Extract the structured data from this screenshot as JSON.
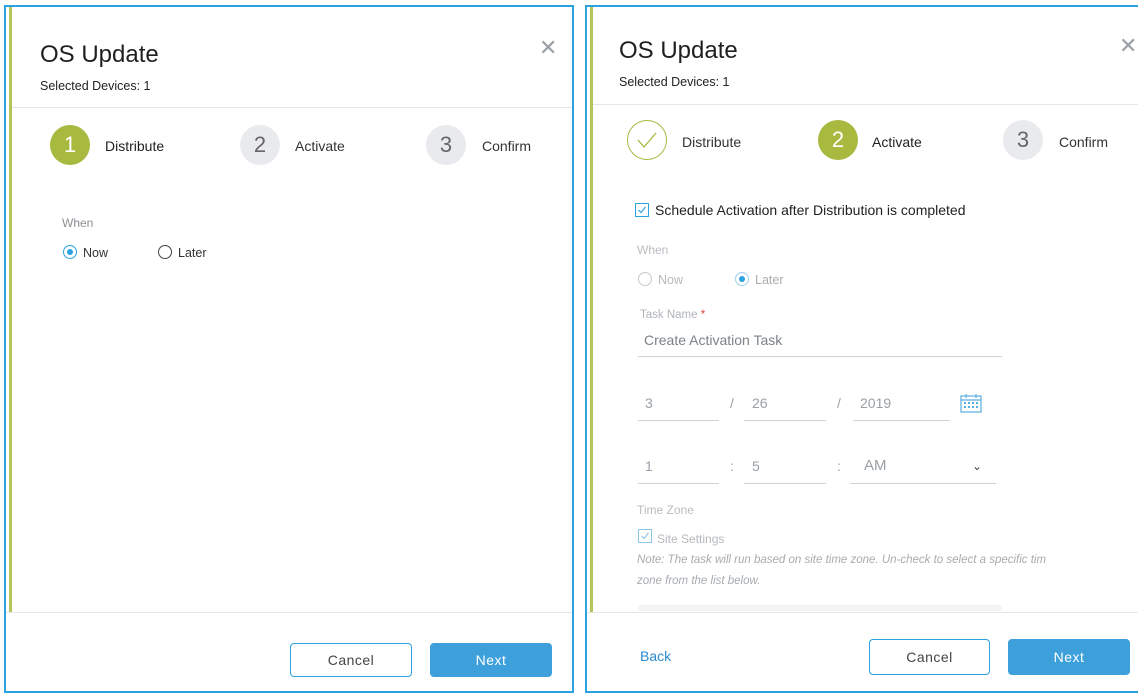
{
  "left": {
    "title": "OS Update",
    "subtitle": "Selected Devices: 1",
    "steps": [
      {
        "number": "1",
        "label": "Distribute",
        "state": "active"
      },
      {
        "number": "2",
        "label": "Activate",
        "state": "inactive"
      },
      {
        "number": "3",
        "label": "Confirm",
        "state": "inactive"
      }
    ],
    "when_label": "When",
    "radio_now": "Now",
    "radio_later": "Later",
    "selected": "Now",
    "cancel_label": "Cancel",
    "next_label": "Next"
  },
  "right": {
    "title": "OS Update",
    "subtitle": "Selected Devices: 1",
    "steps": [
      {
        "number": "",
        "label": "Distribute",
        "state": "done"
      },
      {
        "number": "2",
        "label": "Activate",
        "state": "active"
      },
      {
        "number": "3",
        "label": "Confirm",
        "state": "inactive"
      }
    ],
    "schedule_checkbox_label": "Schedule Activation after Distribution is completed",
    "schedule_checked": true,
    "when_label": "When",
    "radio_now": "Now",
    "radio_later": "Later",
    "selected": "Later",
    "task_name_label": "Task Name",
    "task_name_required": "*",
    "task_name_placeholder": "Create Activation Task",
    "date": {
      "month": "3",
      "day": "26",
      "year": "2019",
      "sep": "/"
    },
    "time": {
      "hour": "1",
      "minute": "5",
      "ampm": "AM",
      "sep": ":"
    },
    "time_zone_label": "Time Zone",
    "site_settings_label": "Site Settings",
    "site_settings_checked": true,
    "note_line1": "Note: The task will run based on site time zone. Un-check to select a specific tim",
    "note_line2": "zone from the list below.",
    "back_label": "Back",
    "cancel_label": "Cancel",
    "next_label": "Next"
  },
  "colors": {
    "accent_green": "#a8b940",
    "accent_blue": "#2aa3e0",
    "primary_button": "#3ea0da"
  },
  "icons": {
    "close": "close-icon",
    "calendar": "calendar-icon",
    "chevron": "chevron-down-icon",
    "check": "check-icon"
  }
}
